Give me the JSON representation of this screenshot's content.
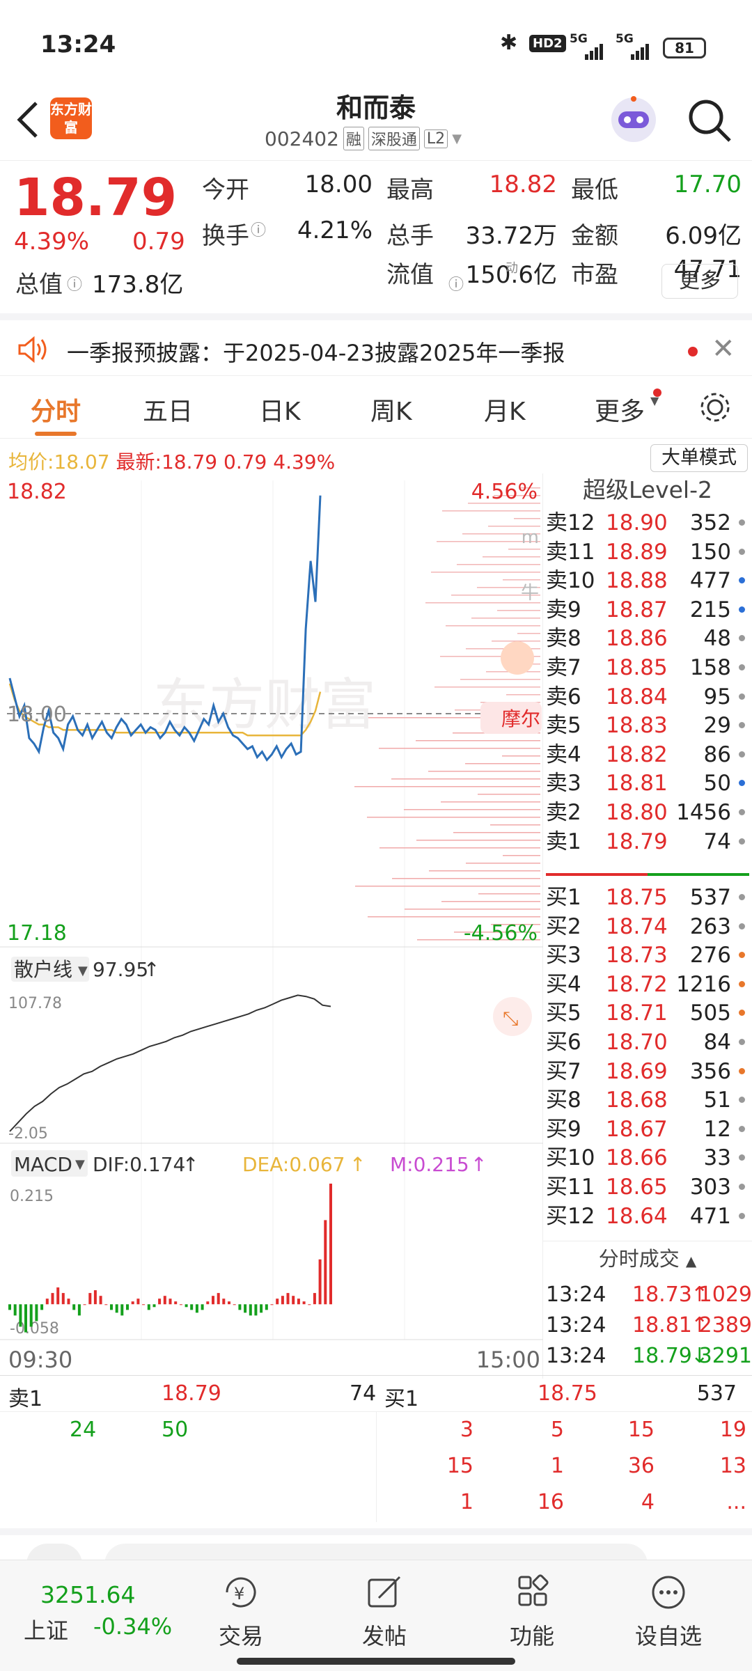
{
  "status_bar": {
    "time": "13:24",
    "network1": "5G",
    "network2": "5G",
    "battery": "81",
    "hd": "HD2"
  },
  "header": {
    "title": "和而泰",
    "code": "002402",
    "badges": [
      "融",
      "深股通",
      "L2"
    ],
    "logo_text": "东方财富"
  },
  "quote": {
    "price": "18.79",
    "change_pct": "4.39%",
    "change": "0.79",
    "cells": [
      {
        "label": "今开",
        "value": "18.00",
        "color": "#222222"
      },
      {
        "label": "最高",
        "value": "18.82",
        "color": "#e12b2b"
      },
      {
        "label": "最低",
        "value": "17.70",
        "color": "#14a01c"
      },
      {
        "label": "换手",
        "value": "4.21%",
        "color": "#222222"
      },
      {
        "label": "总手",
        "value": "33.72万",
        "color": "#222222"
      },
      {
        "label": "金额",
        "value": "6.09亿",
        "color": "#222222"
      },
      {
        "label": "总值",
        "value": "173.8亿",
        "color": "#222222"
      },
      {
        "label": "流值",
        "value": "150.6亿",
        "color": "#222222"
      },
      {
        "label": "市盈",
        "value": "47.71",
        "color": "#222222"
      }
    ],
    "pe_superscript": "动",
    "more_button": "更多"
  },
  "notice": {
    "text": "一季报预披露：于2025-04-23披露2025年一季报"
  },
  "tabs": [
    "分时",
    "五日",
    "日K",
    "周K",
    "月K",
    "更多"
  ],
  "avg_line": {
    "avg_label": "均价:",
    "avg_value": "18.07",
    "latest_label": "最新:",
    "latest_value": "18.79",
    "change": "0.79",
    "change_pct": "4.39%",
    "mode_button": "大单模式"
  },
  "chart": {
    "y_high": "18.82",
    "y_low": "17.18",
    "y_mid": "18.00",
    "pct_high": "4.56%",
    "pct_low": "-4.56%",
    "time_start": "09:30",
    "time_end": "15:00",
    "watermark": "东方财富",
    "side_tag": "摩尔",
    "side_m": "m",
    "side_niu": "牛",
    "price_series": [
      18.12,
      18.05,
      17.98,
      18.02,
      17.9,
      17.88,
      17.85,
      17.94,
      18.0,
      17.92,
      17.9,
      17.86,
      17.95,
      17.98,
      17.93,
      17.91,
      17.95,
      17.9,
      17.93,
      17.96,
      17.92,
      17.9,
      17.94,
      17.97,
      17.95,
      17.91,
      17.93,
      17.95,
      17.92,
      17.94,
      17.93,
      17.9,
      17.92,
      17.96,
      17.93,
      17.91,
      17.94,
      17.92,
      17.89,
      17.93,
      17.97,
      17.95,
      18.02,
      17.96,
      17.99,
      17.94,
      17.91,
      17.9,
      17.88,
      17.86,
      17.87,
      17.83,
      17.85,
      17.82,
      17.84,
      17.87,
      17.83,
      17.86,
      17.88,
      17.84,
      17.85,
      18.3,
      18.55,
      18.4,
      18.79
    ],
    "avg_series": [
      18.1,
      18.04,
      18.0,
      17.98,
      17.97,
      17.96,
      17.95,
      17.95,
      17.94,
      17.94,
      17.94,
      17.93,
      17.93,
      17.93,
      17.93,
      17.93,
      17.93,
      17.93,
      17.93,
      17.93,
      17.93,
      17.93,
      17.92,
      17.92,
      17.92,
      17.92,
      17.92,
      17.92,
      17.92,
      17.92,
      17.92,
      17.92,
      17.92,
      17.92,
      17.92,
      17.92,
      17.92,
      17.92,
      17.92,
      17.92,
      17.92,
      17.92,
      17.92,
      17.92,
      17.92,
      17.92,
      17.92,
      17.92,
      17.92,
      17.91,
      17.91,
      17.91,
      17.91,
      17.91,
      17.91,
      17.91,
      17.91,
      17.91,
      17.91,
      17.91,
      17.91,
      17.93,
      17.96,
      18.0,
      18.07
    ]
  },
  "retail": {
    "label": "散户线",
    "value": "97.95",
    "arrow": "↑",
    "y_top": "107.78",
    "y_bottom": "-2.05",
    "series": [
      -2.05,
      5,
      12,
      18,
      22,
      28,
      33,
      36,
      40,
      44,
      46,
      50,
      53,
      56,
      58,
      60,
      63,
      66,
      68,
      70,
      73,
      75,
      78,
      80,
      82,
      84,
      86,
      88,
      90,
      92,
      95,
      97,
      100,
      103,
      105,
      107,
      106,
      104,
      99,
      98
    ]
  },
  "macd": {
    "label": "MACD",
    "dif": "DIF:0.174",
    "dea": "DEA:0.067",
    "m": "M:0.215",
    "arrow": "↑",
    "y_top": "0.215",
    "y_bottom": "-0.058",
    "bars": [
      -0.01,
      -0.02,
      -0.04,
      -0.05,
      -0.04,
      -0.03,
      -0.01,
      0.01,
      0.02,
      0.03,
      0.02,
      0.01,
      -0.01,
      -0.02,
      0.0,
      0.02,
      0.025,
      0.015,
      0.0,
      -0.01,
      -0.015,
      -0.02,
      -0.01,
      0.005,
      0.01,
      0.0,
      -0.01,
      -0.005,
      0.01,
      0.015,
      0.01,
      0.005,
      0.0,
      -0.005,
      -0.01,
      -0.015,
      -0.01,
      0.005,
      0.015,
      0.02,
      0.01,
      0.005,
      0.0,
      -0.01,
      -0.015,
      -0.02,
      -0.02,
      -0.015,
      -0.01,
      0.0,
      0.01,
      0.015,
      0.02,
      0.015,
      0.01,
      0.005,
      0.0,
      0.02,
      0.08,
      0.15,
      0.215
    ]
  },
  "book_header": "超级Level-2",
  "asks": [
    {
      "label": "卖12",
      "price": "18.90",
      "vol": "352",
      "dot": "#999999"
    },
    {
      "label": "卖11",
      "price": "18.89",
      "vol": "150",
      "dot": "#999999"
    },
    {
      "label": "卖10",
      "price": "18.88",
      "vol": "477",
      "dot": "#2b6fd6"
    },
    {
      "label": "卖9",
      "price": "18.87",
      "vol": "215",
      "dot": "#2b6fd6"
    },
    {
      "label": "卖8",
      "price": "18.86",
      "vol": "48",
      "dot": "#999999"
    },
    {
      "label": "卖7",
      "price": "18.85",
      "vol": "158",
      "dot": "#999999"
    },
    {
      "label": "卖6",
      "price": "18.84",
      "vol": "95",
      "dot": "#999999"
    },
    {
      "label": "卖5",
      "price": "18.83",
      "vol": "29",
      "dot": "#999999"
    },
    {
      "label": "卖4",
      "price": "18.82",
      "vol": "86",
      "dot": "#999999"
    },
    {
      "label": "卖3",
      "price": "18.81",
      "vol": "50",
      "dot": "#2b6fd6"
    },
    {
      "label": "卖2",
      "price": "18.80",
      "vol": "1456",
      "dot": "#999999"
    },
    {
      "label": "卖1",
      "price": "18.79",
      "vol": "74",
      "dot": "#999999"
    }
  ],
  "bids": [
    {
      "label": "买1",
      "price": "18.75",
      "vol": "537",
      "dot": "#999999"
    },
    {
      "label": "买2",
      "price": "18.74",
      "vol": "263",
      "dot": "#999999"
    },
    {
      "label": "买3",
      "price": "18.73",
      "vol": "276",
      "dot": "#e8772b"
    },
    {
      "label": "买4",
      "price": "18.72",
      "vol": "1216",
      "dot": "#e8772b"
    },
    {
      "label": "买5",
      "price": "18.71",
      "vol": "505",
      "dot": "#e8772b"
    },
    {
      "label": "买6",
      "price": "18.70",
      "vol": "84",
      "dot": "#999999"
    },
    {
      "label": "买7",
      "price": "18.69",
      "vol": "356",
      "dot": "#e8772b"
    },
    {
      "label": "买8",
      "price": "18.68",
      "vol": "51",
      "dot": "#999999"
    },
    {
      "label": "买9",
      "price": "18.67",
      "vol": "12",
      "dot": "#999999"
    },
    {
      "label": "买10",
      "price": "18.66",
      "vol": "33",
      "dot": "#999999"
    },
    {
      "label": "买11",
      "price": "18.65",
      "vol": "303",
      "dot": "#999999"
    },
    {
      "label": "买12",
      "price": "18.64",
      "vol": "471",
      "dot": "#999999"
    }
  ],
  "ticks_header": "分时成交",
  "ticks": [
    {
      "time": "13:24",
      "price": "18.73",
      "arrow": "↑",
      "vol": "1029",
      "color": "#e12b2b"
    },
    {
      "time": "13:24",
      "price": "18.81",
      "arrow": "↑",
      "vol": "2389",
      "color": "#e12b2b"
    },
    {
      "time": "13:24",
      "price": "18.79",
      "arrow": "↓",
      "vol": "3291",
      "color": "#14a01c"
    }
  ],
  "queue": {
    "ask_label": "卖1",
    "ask_price": "18.79",
    "ask_vol": "74",
    "bid_label": "买1",
    "bid_price": "18.75",
    "bid_vol": "537",
    "ask_orders": [
      "24",
      "50"
    ],
    "bid_orders": [
      [
        "3",
        "5",
        "15",
        "19"
      ],
      [
        "15",
        "1",
        "36",
        "13"
      ],
      [
        "1",
        "16",
        "4",
        "..."
      ]
    ]
  },
  "bottom_nav": {
    "index_value": "3251.64",
    "index_name": "上证",
    "index_change": "-0.34%",
    "items": [
      "交易",
      "发帖",
      "功能",
      "设自选"
    ]
  },
  "colors": {
    "up": "#e12b2b",
    "down": "#14a01c",
    "accent": "#f25d1d",
    "avg": "#e8b53a",
    "price_line": "#2b6fb8"
  }
}
